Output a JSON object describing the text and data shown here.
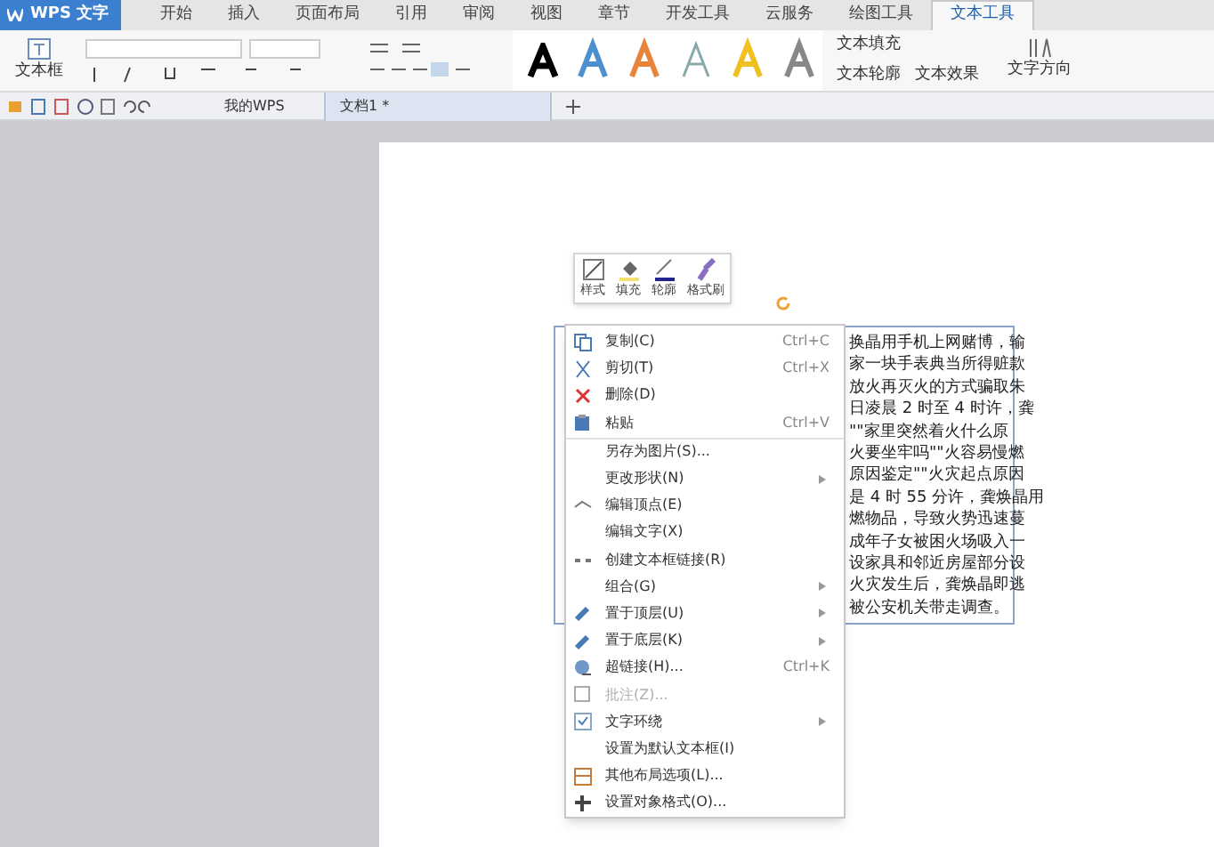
{
  "app_button": {
    "label": "WPS 文字"
  },
  "ribbon_tabs": [
    {
      "label": "开始",
      "selected": false
    },
    {
      "label": "插入",
      "selected": false
    },
    {
      "label": "页面布局",
      "selected": false
    },
    {
      "label": "引用",
      "selected": false
    },
    {
      "label": "审阅",
      "selected": false
    },
    {
      "label": "视图",
      "selected": false
    },
    {
      "label": "章节",
      "selected": false
    },
    {
      "label": "开发工具",
      "selected": false
    },
    {
      "label": "云服务",
      "selected": false
    },
    {
      "label": "绘图工具",
      "selected": false
    },
    {
      "label": "文本工具",
      "selected": true
    }
  ],
  "ribbon": {
    "textbox_label": "文本框",
    "text_fill": "文本填充",
    "text_outline": "文本轮廓",
    "text_effect": "文本效果",
    "text_direction": "文字方向"
  },
  "doc_tabs": [
    {
      "label": "我的WPS",
      "selected": false
    },
    {
      "label": "文档1 *",
      "selected": true
    }
  ],
  "mini_toolbar": [
    "样式",
    "填充",
    "轮廓",
    "格式刷"
  ],
  "text_box_lines": [
    "换晶用手机上网赌博，输",
    "家一块手表典当所得赃款",
    "放火再灭火的方式骗取朱",
    "日凌晨 2 时至 4 时许，龚",
    "\"\"家里突然着火什么原",
    "火要坐牢吗\"\"火容易慢燃",
    "原因鉴定\"\"火灾起点原因",
    "是 4 时 55 分许，龚焕晶用",
    "燃物品，导致火势迅速蔓",
    "成年子女被困火场吸入一",
    "设家具和邻近房屋部分设",
    "火灾发生后，龚焕晶即逃",
    "被公安机关带走调查。"
  ],
  "context_menu": [
    {
      "label": "复制(C)",
      "shortcut": "Ctrl+C",
      "kind": "copy",
      "submenu": false,
      "disabled": false,
      "separator_before": false
    },
    {
      "label": "剪切(T)",
      "shortcut": "Ctrl+X",
      "kind": "cut",
      "submenu": false,
      "disabled": false,
      "separator_before": false
    },
    {
      "label": "删除(D)",
      "kind": "delete",
      "submenu": false,
      "disabled": false,
      "separator_before": false
    },
    {
      "label": "粘贴",
      "shortcut": "Ctrl+V",
      "kind": "paste",
      "submenu": false,
      "disabled": false,
      "separator_before": false
    },
    {
      "label": "另存为图片(S)...",
      "kind": "plain",
      "submenu": false,
      "disabled": false,
      "separator_before": true
    },
    {
      "label": "更改形状(N)",
      "kind": "plain",
      "submenu": true,
      "disabled": false,
      "separator_before": false
    },
    {
      "label": "编辑顶点(E)",
      "kind": "vertex",
      "submenu": false,
      "disabled": false,
      "separator_before": false
    },
    {
      "label": "编辑文字(X)",
      "kind": "plain",
      "submenu": false,
      "disabled": false,
      "separator_before": false
    },
    {
      "label": "创建文本框链接(R)",
      "kind": "link",
      "submenu": false,
      "disabled": false,
      "separator_before": false
    },
    {
      "label": "组合(G)",
      "kind": "plain",
      "submenu": true,
      "disabled": false,
      "separator_before": false
    },
    {
      "label": "置于顶层(U)",
      "kind": "front",
      "submenu": true,
      "disabled": false,
      "separator_before": false
    },
    {
      "label": "置于底层(K)",
      "kind": "back",
      "submenu": true,
      "disabled": false,
      "separator_before": false
    },
    {
      "label": "超链接(H)...",
      "shortcut": "Ctrl+K",
      "kind": "hyperlink",
      "submenu": false,
      "disabled": false,
      "separator_before": false
    },
    {
      "label": "批注(Z)...",
      "kind": "comment",
      "submenu": false,
      "disabled": true,
      "separator_before": false
    },
    {
      "label": "文字环绕",
      "kind": "wrap",
      "submenu": true,
      "disabled": false,
      "separator_before": false
    },
    {
      "label": "设置为默认文本框(I)",
      "kind": "plain",
      "submenu": false,
      "disabled": false,
      "separator_before": false
    },
    {
      "label": "其他布局选项(L)...",
      "kind": "layout",
      "submenu": false,
      "disabled": false,
      "separator_before": false
    },
    {
      "label": "设置对象格式(O)...",
      "kind": "format",
      "submenu": false,
      "disabled": false,
      "separator_before": false
    }
  ]
}
